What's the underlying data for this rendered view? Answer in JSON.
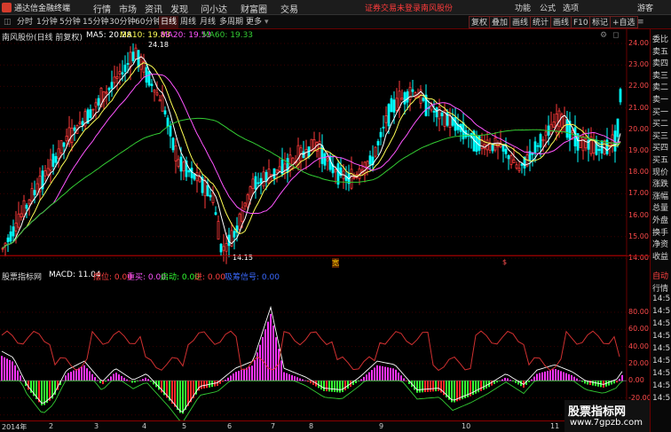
{
  "titlebar": {
    "app_name": "通达信金融终端",
    "menus": [
      "行情",
      "市场",
      "资讯",
      "发现",
      "问小达",
      "财富圈",
      "交易"
    ],
    "alert": "证券交易未登录",
    "stock_link": "南风股份",
    "right_items": [
      "功能",
      "公式",
      "选项",
      "游客"
    ]
  },
  "toolbar": {
    "periods": [
      "分时",
      "1分钟",
      "5分钟",
      "15分钟",
      "30分钟",
      "60分钟",
      "日线",
      "周线",
      "月线",
      "多周期",
      "更多"
    ],
    "active_period": "日线",
    "right_buttons": [
      "复权",
      "叠加",
      "画线",
      "统计",
      "画线",
      "F10",
      "标记",
      "+自选"
    ]
  },
  "price_header": {
    "stock": "南风股份(日线 前复权)",
    "ma5": "MA5: 20.28",
    "ma10": "MA10: 19.83",
    "ma20": "MA20: 19.53",
    "ma60": "MA60: 19.33"
  },
  "indicator_header": {
    "name": "股票指标网",
    "macd": "MACD: 11.04",
    "item2": "摆位: 0.00",
    "item3": "重买: 0.00",
    "item4": "启动: 0.00",
    "item5": "进: 0.00",
    "item6": "吸筹信号: 0.00"
  },
  "annotations": {
    "high": "24.18",
    "low": "14.15",
    "mark1": "宽",
    "mark2": "$"
  },
  "side_panel": [
    "委比",
    "卖五",
    "卖四",
    "卖三",
    "卖二",
    "卖一",
    "买一",
    "买二",
    "买三",
    "买四",
    "买五",
    "现价",
    "涨跌",
    "涨幅",
    "总量",
    "外盘",
    "换手",
    "净资",
    "收益"
  ],
  "side_panel2": [
    "自动",
    "行情",
    "14:5",
    "14:5",
    "14:5",
    "14:5",
    "14:5",
    "14:5",
    "14:5",
    "14:5",
    "14:5"
  ],
  "price_axis": [
    "24.00",
    "23.00",
    "22.00",
    "21.00",
    "20.00",
    "19.00",
    "18.00",
    "17.00",
    "16.00",
    "15.00",
    "14.00"
  ],
  "indicator_axis": [
    "80.00",
    "60.00",
    "40.00",
    "20.00",
    "0.00",
    "-20.00",
    "-40.00"
  ],
  "date_axis": [
    "2014年",
    "2",
    "3",
    "4",
    "5",
    "6",
    "7",
    "8",
    "9",
    "10",
    "11"
  ],
  "watermark": {
    "title": "股票指标网",
    "url": "www.7gpzb.com"
  },
  "colors": {
    "up": "#ff3a3a",
    "down": "#00ffff",
    "ma5": "#ffffff",
    "ma10": "#ffff55",
    "ma20": "#ff55ff",
    "ma60": "#33cc33",
    "pos_hist": "#ff33ff",
    "neg_hist": "#33ff33",
    "red_bar": "#ff2a2a"
  }
}
